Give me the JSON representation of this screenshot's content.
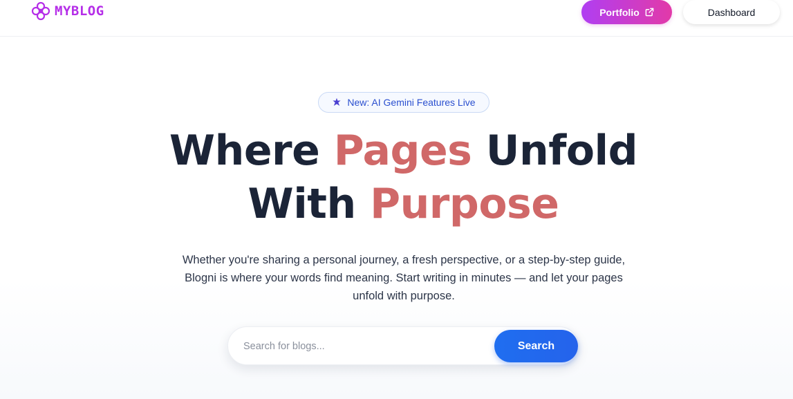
{
  "header": {
    "logo_text": "MYBLOG",
    "portfolio_label": "Portfolio",
    "dashboard_label": "Dashboard"
  },
  "hero": {
    "badge": "New: AI Gemini Features Live",
    "headline": {
      "line1_a": "Where ",
      "line1_accent": "Pages",
      "line1_b": " Unfold",
      "line2_a": "With ",
      "line2_accent": "Purpose"
    },
    "lead": "Whether you're sharing a personal journey, a fresh perspective, or a step-by-step guide, Blogni is where your words find meaning. Start writing in minutes — and let your pages unfold with purpose."
  },
  "search": {
    "placeholder": "Search for blogs...",
    "value": "",
    "button_label": "Search"
  },
  "colors": {
    "brand": "#b52ee8",
    "accent": "#d06868",
    "headline": "#1b2437",
    "primary": "#2563eb"
  },
  "icons": {
    "logo": "flower-logo-icon",
    "portfolio": "external-link-icon",
    "badge": "sparkle-icon"
  }
}
